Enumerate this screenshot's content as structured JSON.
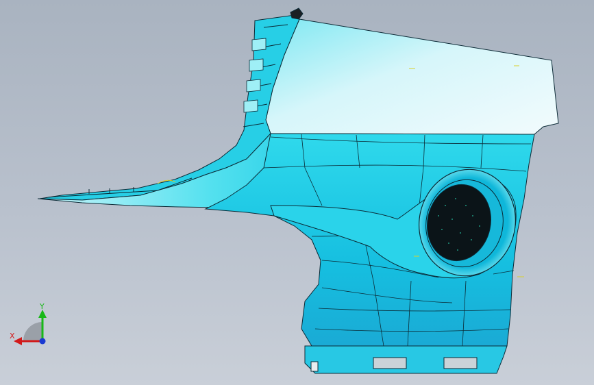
{
  "viewport": {
    "background_top": "#a9b3c0",
    "background_bottom": "#c9cfd8"
  },
  "model": {
    "primary_color": "#1fd0e6",
    "highlight_color": "#d9f6fb",
    "edge_color": "#0b2a36",
    "annotation_color": "#d8d02a"
  },
  "triad": {
    "x_label": "X",
    "y_label": "Y",
    "x_color": "#d21a1a",
    "y_color": "#18b818",
    "z_color": "#1a3ad2",
    "icon": "coordinate-triad-icon"
  }
}
